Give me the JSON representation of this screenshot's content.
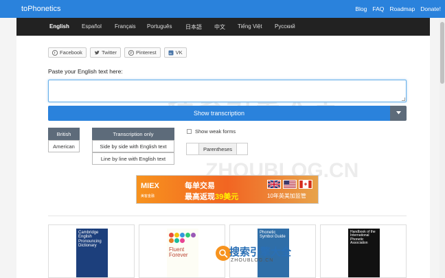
{
  "topbar": {
    "brand": "toPhonetics",
    "links": [
      "Blog",
      "FAQ",
      "Roadmap",
      "Donate!"
    ]
  },
  "languages": {
    "items": [
      "English",
      "Español",
      "Français",
      "Português",
      "日本語",
      "中文",
      "Tiếng Việt",
      "Русский"
    ],
    "active": "English"
  },
  "social": {
    "facebook": "Facebook",
    "twitter": "Twitter",
    "pinterest": "Pinterest",
    "vk": "VK"
  },
  "form": {
    "paste_label": "Paste your English text here:",
    "input_value": "",
    "show_button": "Show transcription"
  },
  "accent": {
    "british": "British",
    "american": "American",
    "selected": "British"
  },
  "mode": {
    "transcription_only": "Transcription only",
    "side_by_side": "Side by side with English text",
    "line_by_line": "Line by line with English text",
    "selected": "Transcription only"
  },
  "options": {
    "weak_forms": "Show weak forms",
    "weak_forms_checked": false,
    "parentheses": "Parentheses"
  },
  "ad": {
    "brand": "MIEX",
    "brand_sub": "美客金融",
    "line1": "每单交易",
    "line2_prefix": "最高返现",
    "line2_amount": "39美元",
    "line3": "10年英美加监管"
  },
  "books": [
    {
      "title": "Cambridge English Pronouncing Dictionary"
    },
    {
      "title": "Fluent Forever"
    },
    {
      "title": "Phonetic Symbol Guide"
    },
    {
      "title": "Handbook of the International Phonetic Association"
    }
  ],
  "watermark": {
    "cn": "搜索引擎大全",
    "en": "ZHOUBLOG.CN"
  },
  "colors": {
    "primary": "#2a82dc",
    "nav_dark": "#222222",
    "segment_active": "#5d6b7a"
  }
}
